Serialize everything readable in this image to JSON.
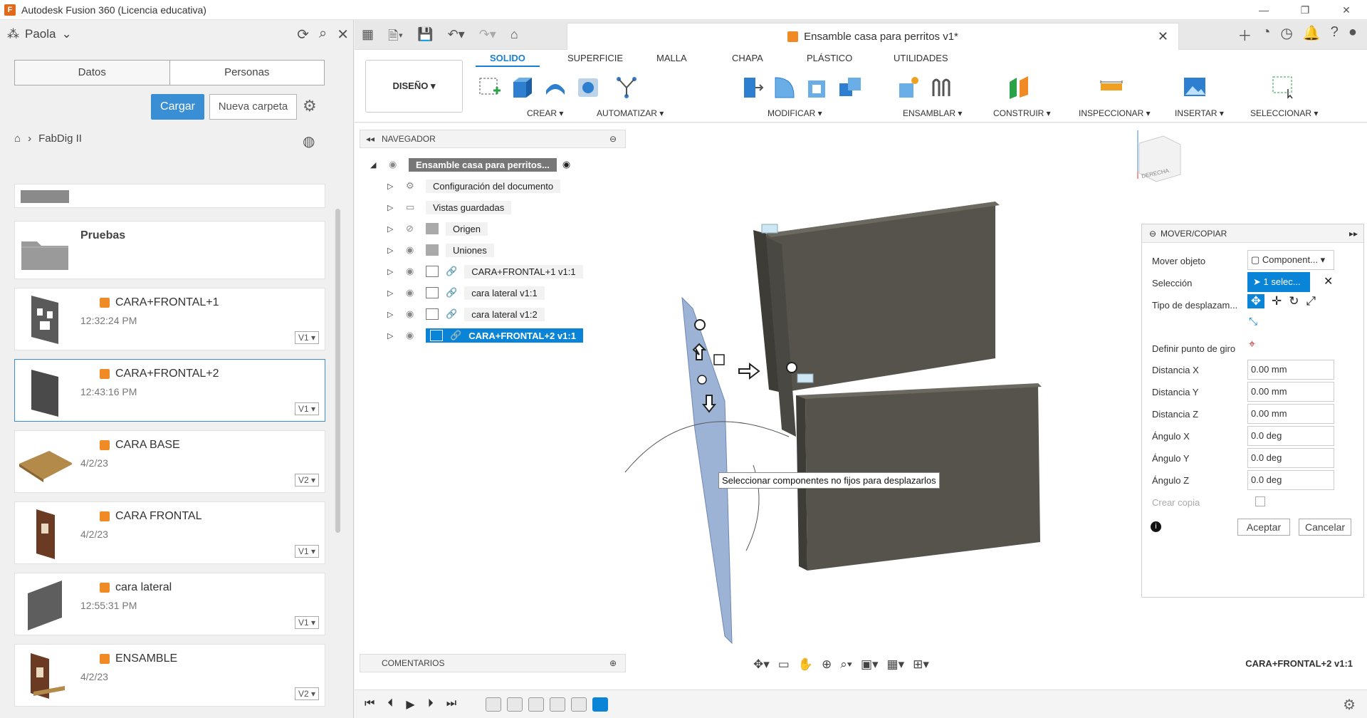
{
  "window": {
    "title": "Autodesk Fusion 360 (Licencia educativa)",
    "controls": [
      "—",
      "❐",
      "✕"
    ]
  },
  "left_panel": {
    "user": "Paola",
    "tabs": [
      "Datos",
      "Personas"
    ],
    "upload_button": "Cargar",
    "new_folder_button": "Nueva carpeta",
    "breadcrumb": "FabDig II",
    "items": [
      {
        "name": "Pruebas",
        "date": "",
        "version": "",
        "type": "folder"
      },
      {
        "name": "CARA+FRONTAL+1",
        "date": "12:32:24 PM",
        "version": "V1"
      },
      {
        "name": "CARA+FRONTAL+2",
        "date": "12:43:16 PM",
        "version": "V1",
        "selected": true
      },
      {
        "name": "CARA BASE",
        "date": "4/2/23",
        "version": "V2"
      },
      {
        "name": "CARA FRONTAL",
        "date": "4/2/23",
        "version": "V1"
      },
      {
        "name": "cara lateral",
        "date": "12:55:31 PM",
        "version": "V1"
      },
      {
        "name": "ENSAMBLE",
        "date": "4/2/23",
        "version": "V2"
      }
    ]
  },
  "document_tab": {
    "title": "Ensamble casa para perritos v1*"
  },
  "ribbon": {
    "workspace": "DISEÑO ▾",
    "tabs": [
      "SOLIDO",
      "SUPERFICIE",
      "MALLA",
      "CHAPA",
      "PLÁSTICO",
      "UTILIDADES"
    ],
    "groups": [
      "CREAR ▾",
      "AUTOMATIZAR ▾",
      "MODIFICAR ▾",
      "ENSAMBLAR ▾",
      "CONSTRUIR ▾",
      "INSPECCIONAR ▾",
      "INSERTAR ▾",
      "SELECCIONAR ▾"
    ]
  },
  "browser": {
    "title": "NAVEGADOR",
    "root": "Ensamble casa para perritos...",
    "nodes": [
      "Configuración del documento",
      "Vistas guardadas",
      "Origen",
      "Uniones",
      "CARA+FRONTAL+1 v1:1",
      "cara lateral v1:1",
      "cara lateral v1:2",
      "CARA+FRONTAL+2 v1:1"
    ]
  },
  "comments_label": "COMENTARIOS",
  "tooltip": "Seleccionar componentes no fijos para desplazarlos",
  "move_copy": {
    "title": "MOVER/COPIAR",
    "move_object_label": "Mover objeto",
    "move_object_value": "Component...",
    "selection_label": "Selección",
    "selection_value": "1 selec...",
    "move_type_label": "Tipo de desplazam...",
    "pivot_label": "Definir punto de giro",
    "dist_x_label": "Distancia X",
    "dist_x": "0.00 mm",
    "dist_y_label": "Distancia Y",
    "dist_y": "0.00 mm",
    "dist_z_label": "Distancia Z",
    "dist_z": "0.00 mm",
    "ang_x_label": "Ángulo X",
    "ang_x": "0.0 deg",
    "ang_y_label": "Ángulo Y",
    "ang_y": "0.0 deg",
    "ang_z_label": "Ángulo Z",
    "ang_z": "0.0 deg",
    "copy_label": "Crear copia",
    "ok": "Aceptar",
    "cancel": "Cancelar"
  },
  "viewcube_label": "DERECHA",
  "status_selection": "CARA+FRONTAL+2 v1:1"
}
